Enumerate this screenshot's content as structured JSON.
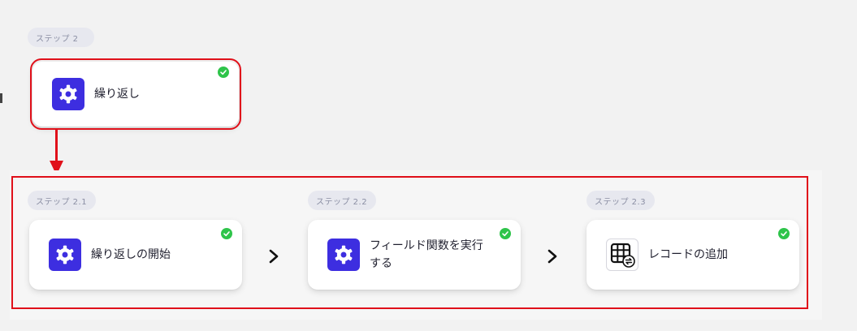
{
  "step_main": {
    "pill": "ステップ 2",
    "label": "繰り返し",
    "icon": "gear-icon",
    "status": "completed"
  },
  "substeps": [
    {
      "pill": "ステップ 2.1",
      "label": "繰り返しの開始",
      "icon": "gear-icon",
      "status": "completed"
    },
    {
      "pill": "ステップ 2.2",
      "label": "フィールド関数を実行する",
      "label_line1": "フィールド関数を実行",
      "label_line2": "する",
      "icon": "gear-icon",
      "status": "completed"
    },
    {
      "pill": "ステップ 2.3",
      "label": "レコードの追加",
      "icon": "table-sync-icon",
      "status": "completed"
    }
  ],
  "colors": {
    "accent": "#3d2ee0",
    "success": "#2ec44a",
    "highlight": "#e0101a",
    "background": "#f2f2f2"
  }
}
